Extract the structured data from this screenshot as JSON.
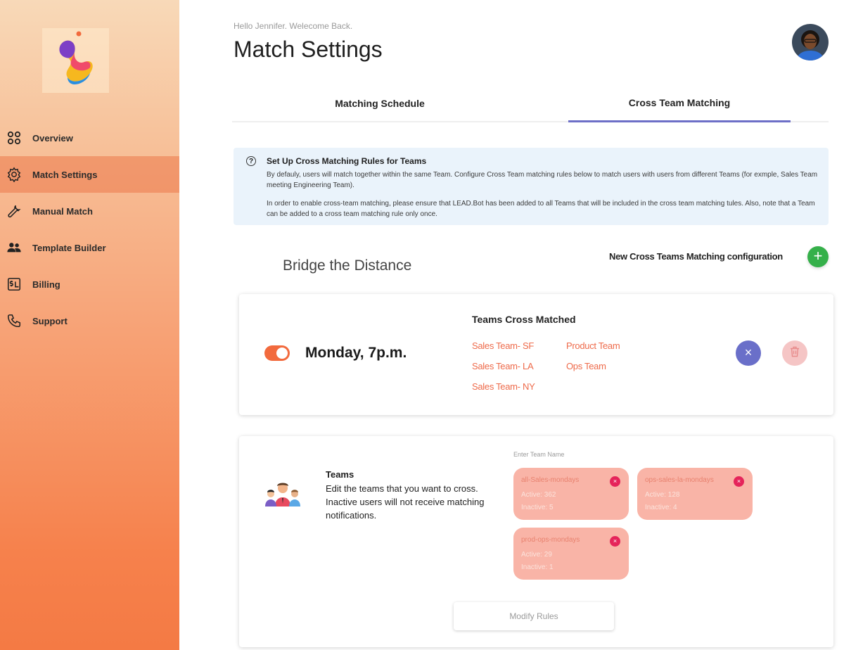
{
  "header": {
    "greeting": "Hello Jennifer. Welecome Back.",
    "title": "Match Settings"
  },
  "sidebar": {
    "items": [
      {
        "label": "Overview",
        "icon": "overview-icon",
        "active": false
      },
      {
        "label": "Match Settings",
        "icon": "gear-icon",
        "active": true
      },
      {
        "label": "Manual Match",
        "icon": "wrench-icon",
        "active": false
      },
      {
        "label": "Template Builder",
        "icon": "people-icon",
        "active": false
      },
      {
        "label": "Billing",
        "icon": "billing-icon",
        "active": false
      },
      {
        "label": "Support",
        "icon": "phone-icon",
        "active": false
      }
    ]
  },
  "tabs": [
    {
      "label": "Matching Schedule",
      "active": false
    },
    {
      "label": "Cross Team Matching",
      "active": true
    }
  ],
  "info": {
    "title": "Set Up Cross Matching Rules for Teams",
    "paragraph1": "By defauly, users will match together within the same Team. Configure Cross Team matching rules below to match users with users from different Teams (for exmple, Sales Team meeting Engineering Team).",
    "paragraph2": "In order to enable cross-team matching, please ensure that LEAD.Bot has been added to all Teams that will be included in the cross team matching tules. Also, note that a Team can be added to a cross team matching rule only once."
  },
  "section": {
    "title": "Bridge the Distance",
    "new_config_label": "New Cross Teams Matching configuration",
    "add_symbol": "+"
  },
  "rule_card": {
    "enabled": true,
    "schedule": "Monday, 7p.m.",
    "teams_title": "Teams Cross Matched",
    "teams": [
      "Sales Team- SF",
      "Sales Team- LA",
      "Sales Team- NY",
      "Product Team",
      "Ops Team"
    ],
    "close_symbol": "×"
  },
  "teams_card": {
    "title": "Teams",
    "description": "Edit the teams that you want to cross. Inactive users will not receive matching notifications.",
    "input_label": "Enter Team Name",
    "chips": [
      {
        "name": "all-Sales-mondays",
        "active": "Active: 362",
        "inactive": "Inactive: 5"
      },
      {
        "name": "ops-sales-la-mondays",
        "active": "Active: 128",
        "inactive": "Inactive: 4"
      },
      {
        "name": "prod-ops-mondays",
        "active": "Active: 29",
        "inactive": "Inactive: 1"
      }
    ],
    "remove_symbol": "×",
    "modify_button": "Modify Rules"
  },
  "colors": {
    "accent_orange": "#f26a3d",
    "tab_underline": "#6d6fc7",
    "add_green": "#35b04a",
    "team_link": "#ee6a4a",
    "chip_bg": "#f9b4a7",
    "chip_remove": "#e5245a"
  }
}
